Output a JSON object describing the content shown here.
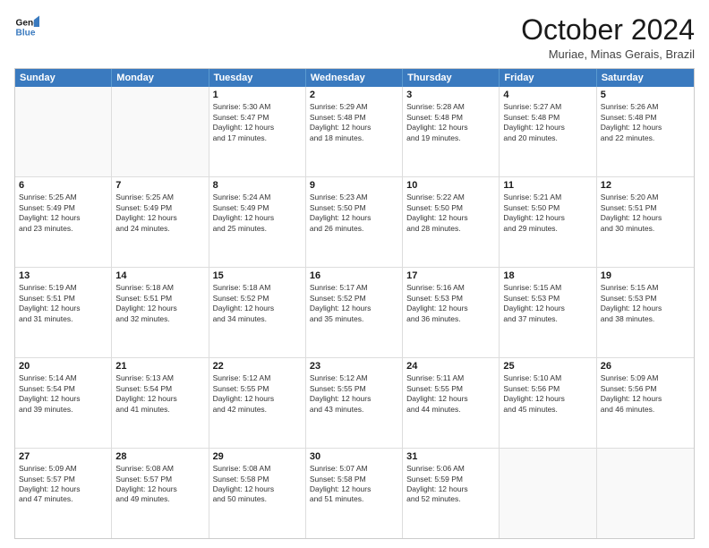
{
  "logo": {
    "line1": "General",
    "line2": "Blue"
  },
  "title": "October 2024",
  "location": "Muriae, Minas Gerais, Brazil",
  "header_days": [
    "Sunday",
    "Monday",
    "Tuesday",
    "Wednesday",
    "Thursday",
    "Friday",
    "Saturday"
  ],
  "weeks": [
    [
      {
        "day": "",
        "info": ""
      },
      {
        "day": "",
        "info": ""
      },
      {
        "day": "1",
        "info": "Sunrise: 5:30 AM\nSunset: 5:47 PM\nDaylight: 12 hours\nand 17 minutes."
      },
      {
        "day": "2",
        "info": "Sunrise: 5:29 AM\nSunset: 5:48 PM\nDaylight: 12 hours\nand 18 minutes."
      },
      {
        "day": "3",
        "info": "Sunrise: 5:28 AM\nSunset: 5:48 PM\nDaylight: 12 hours\nand 19 minutes."
      },
      {
        "day": "4",
        "info": "Sunrise: 5:27 AM\nSunset: 5:48 PM\nDaylight: 12 hours\nand 20 minutes."
      },
      {
        "day": "5",
        "info": "Sunrise: 5:26 AM\nSunset: 5:48 PM\nDaylight: 12 hours\nand 22 minutes."
      }
    ],
    [
      {
        "day": "6",
        "info": "Sunrise: 5:25 AM\nSunset: 5:49 PM\nDaylight: 12 hours\nand 23 minutes."
      },
      {
        "day": "7",
        "info": "Sunrise: 5:25 AM\nSunset: 5:49 PM\nDaylight: 12 hours\nand 24 minutes."
      },
      {
        "day": "8",
        "info": "Sunrise: 5:24 AM\nSunset: 5:49 PM\nDaylight: 12 hours\nand 25 minutes."
      },
      {
        "day": "9",
        "info": "Sunrise: 5:23 AM\nSunset: 5:50 PM\nDaylight: 12 hours\nand 26 minutes."
      },
      {
        "day": "10",
        "info": "Sunrise: 5:22 AM\nSunset: 5:50 PM\nDaylight: 12 hours\nand 28 minutes."
      },
      {
        "day": "11",
        "info": "Sunrise: 5:21 AM\nSunset: 5:50 PM\nDaylight: 12 hours\nand 29 minutes."
      },
      {
        "day": "12",
        "info": "Sunrise: 5:20 AM\nSunset: 5:51 PM\nDaylight: 12 hours\nand 30 minutes."
      }
    ],
    [
      {
        "day": "13",
        "info": "Sunrise: 5:19 AM\nSunset: 5:51 PM\nDaylight: 12 hours\nand 31 minutes."
      },
      {
        "day": "14",
        "info": "Sunrise: 5:18 AM\nSunset: 5:51 PM\nDaylight: 12 hours\nand 32 minutes."
      },
      {
        "day": "15",
        "info": "Sunrise: 5:18 AM\nSunset: 5:52 PM\nDaylight: 12 hours\nand 34 minutes."
      },
      {
        "day": "16",
        "info": "Sunrise: 5:17 AM\nSunset: 5:52 PM\nDaylight: 12 hours\nand 35 minutes."
      },
      {
        "day": "17",
        "info": "Sunrise: 5:16 AM\nSunset: 5:53 PM\nDaylight: 12 hours\nand 36 minutes."
      },
      {
        "day": "18",
        "info": "Sunrise: 5:15 AM\nSunset: 5:53 PM\nDaylight: 12 hours\nand 37 minutes."
      },
      {
        "day": "19",
        "info": "Sunrise: 5:15 AM\nSunset: 5:53 PM\nDaylight: 12 hours\nand 38 minutes."
      }
    ],
    [
      {
        "day": "20",
        "info": "Sunrise: 5:14 AM\nSunset: 5:54 PM\nDaylight: 12 hours\nand 39 minutes."
      },
      {
        "day": "21",
        "info": "Sunrise: 5:13 AM\nSunset: 5:54 PM\nDaylight: 12 hours\nand 41 minutes."
      },
      {
        "day": "22",
        "info": "Sunrise: 5:12 AM\nSunset: 5:55 PM\nDaylight: 12 hours\nand 42 minutes."
      },
      {
        "day": "23",
        "info": "Sunrise: 5:12 AM\nSunset: 5:55 PM\nDaylight: 12 hours\nand 43 minutes."
      },
      {
        "day": "24",
        "info": "Sunrise: 5:11 AM\nSunset: 5:55 PM\nDaylight: 12 hours\nand 44 minutes."
      },
      {
        "day": "25",
        "info": "Sunrise: 5:10 AM\nSunset: 5:56 PM\nDaylight: 12 hours\nand 45 minutes."
      },
      {
        "day": "26",
        "info": "Sunrise: 5:09 AM\nSunset: 5:56 PM\nDaylight: 12 hours\nand 46 minutes."
      }
    ],
    [
      {
        "day": "27",
        "info": "Sunrise: 5:09 AM\nSunset: 5:57 PM\nDaylight: 12 hours\nand 47 minutes."
      },
      {
        "day": "28",
        "info": "Sunrise: 5:08 AM\nSunset: 5:57 PM\nDaylight: 12 hours\nand 49 minutes."
      },
      {
        "day": "29",
        "info": "Sunrise: 5:08 AM\nSunset: 5:58 PM\nDaylight: 12 hours\nand 50 minutes."
      },
      {
        "day": "30",
        "info": "Sunrise: 5:07 AM\nSunset: 5:58 PM\nDaylight: 12 hours\nand 51 minutes."
      },
      {
        "day": "31",
        "info": "Sunrise: 5:06 AM\nSunset: 5:59 PM\nDaylight: 12 hours\nand 52 minutes."
      },
      {
        "day": "",
        "info": ""
      },
      {
        "day": "",
        "info": ""
      }
    ]
  ]
}
